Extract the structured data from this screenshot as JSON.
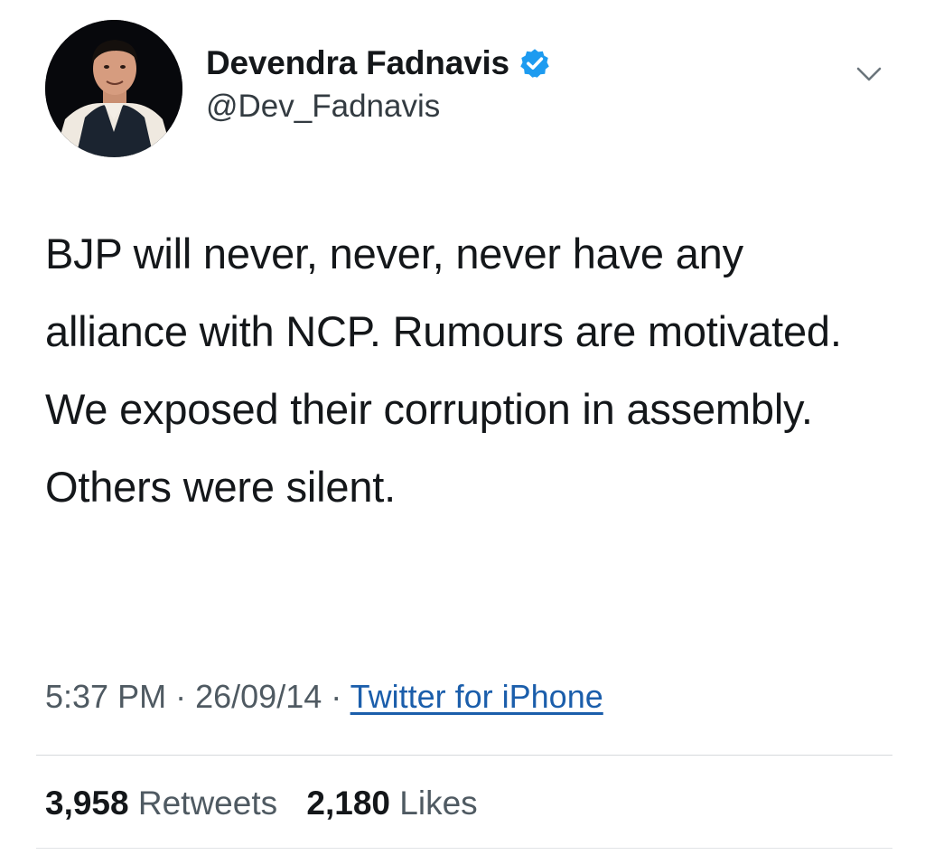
{
  "user": {
    "display_name": "Devendra Fadnavis",
    "handle": "@Dev_Fadnavis",
    "verified": true,
    "avatar_icon": "profile-photo"
  },
  "menu": {
    "icon": "chevron-down-icon"
  },
  "tweet": {
    "text": "BJP will never, never, never have any alliance with NCP. Rumours are motivated. We exposed their corruption in assembly. Others were silent."
  },
  "meta": {
    "time": "5:37 PM",
    "separator": "·",
    "date": "26/09/14",
    "source": "Twitter for iPhone"
  },
  "stats": {
    "retweets_count": "3,958",
    "retweets_label": "Retweets",
    "likes_count": "2,180",
    "likes_label": "Likes"
  },
  "colors": {
    "verified_badge": "#1d9bf0",
    "link": "#1b5eab",
    "text": "#14171a",
    "secondary_text": "#4f5a62"
  }
}
